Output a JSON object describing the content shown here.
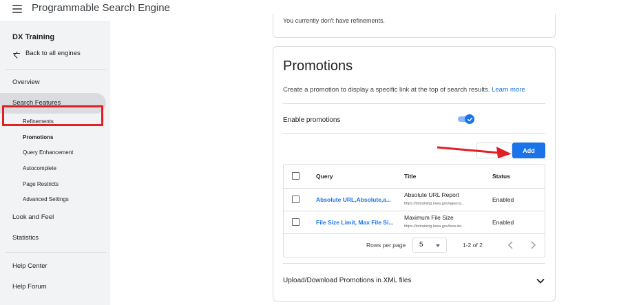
{
  "app": {
    "title": "Programmable Search Engine"
  },
  "sidebar": {
    "engine_name": "DX Training",
    "back_label": "Back to all engines",
    "items": [
      {
        "label": "Overview"
      },
      {
        "label": "Search Features"
      },
      {
        "label": "Look and Feel"
      },
      {
        "label": "Statistics"
      },
      {
        "label": "Help Center"
      },
      {
        "label": "Help Forum"
      }
    ],
    "sub_items": [
      {
        "label": "Refinements"
      },
      {
        "label": "Promotions"
      },
      {
        "label": "Query Enhancement"
      },
      {
        "label": "Autocomplete"
      },
      {
        "label": "Page Restricts"
      },
      {
        "label": "Advanced Settings"
      }
    ]
  },
  "refinements_card": {
    "text": "You currently don't have refinements."
  },
  "promotions": {
    "title": "Promotions",
    "description": "Create a promotion to display a specific link at the top of search results.",
    "learn_more": "Learn more",
    "enable_label": "Enable promotions",
    "enabled": true,
    "add_button": "Add",
    "table": {
      "headers": {
        "query": "Query",
        "title": "Title",
        "status": "Status"
      },
      "rows": [
        {
          "query": "Absolute URL,Absolute,a...",
          "title": "Absolute URL Report",
          "url": "https://dxtraining.iowa.gov/agency...",
          "status": "Enabled"
        },
        {
          "query": "File Size Limit, Max File Si...",
          "title": "Maximum File Size",
          "url": "https://dxtraining.iowa.gov/how-do...",
          "status": "Enabled"
        }
      ],
      "rows_per_page_label": "Rows per page",
      "rows_per_page": "5",
      "range": "1-2 of 2"
    },
    "upload_label": "Upload/Download Promotions in XML files"
  },
  "colors": {
    "accent": "#1a73e8",
    "annotation_red": "#e31e24"
  },
  "icons": [
    "menu-icon",
    "arrow-left-icon",
    "check-icon",
    "chevron-down-icon",
    "chevron-left-icon",
    "chevron-right-icon",
    "expand-icon"
  ]
}
